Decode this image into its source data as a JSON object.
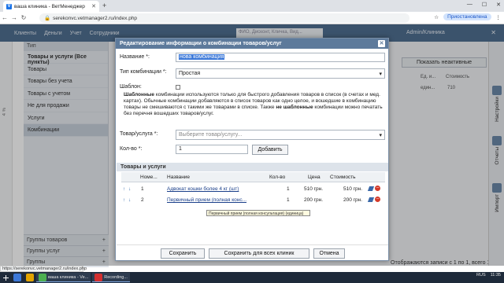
{
  "browser": {
    "tab_title": "ваша клиника - ВетМенеджер",
    "url": "serekonvc.vetmanager2.ru/index.php",
    "pause_label": "Приостановлена",
    "status_url": "https://serekonvc.vetmanager2.ru/index.php"
  },
  "app_header": {
    "menu": [
      "Клиенты",
      "Деньги",
      "Учет",
      "Сотрудники"
    ],
    "search_placeholder": "ФИО, Дисконт, Кличка, Вид...",
    "clinic": "Admin/Клиника"
  },
  "left_panel": {
    "title": "Тип",
    "items": [
      {
        "label": "Товары и услуги (Все пункты)"
      },
      {
        "label": "Товары"
      },
      {
        "label": "Товары без учета"
      },
      {
        "label": "Товары с учетом"
      },
      {
        "label": "Не для продажи"
      },
      {
        "label": "Услуги"
      },
      {
        "label": "Комбинации"
      }
    ],
    "sections": [
      "Группы товаров",
      "Группы услуг",
      "Группы"
    ],
    "percent": "4 %"
  },
  "right_area": {
    "show_inactive": "Показать неактивные",
    "columns": [
      "Ед. и...",
      "Стоимость"
    ],
    "row": [
      "един...",
      "710"
    ],
    "records": "Отображаются записи с 1 по 1, всего 1"
  },
  "right_sidebar": [
    "Настройки",
    "Отчеты",
    "Импорт"
  ],
  "modal": {
    "title": "Редактирование информации о комбинации товаров/услуг",
    "name_label": "Название *:",
    "name_value": "нова комбинация",
    "type_label": "Тип комбинации *:",
    "type_value": "Простая",
    "template_label": "Шаблон:",
    "description_bold": "Шаблонные",
    "description": "комбинации используются только для быстрого добавления товаров в список (в счетах и мед. картах). Обычные комбинации добавляются в список товаров как одно целое, и вошедшие в комбинацию товары не смешиваются с такими же товарами в списке. Также",
    "description_bold2": "не шаблонные",
    "description_end": "комбинации можно печатать без перечня вошедших товаров/услуг.",
    "product_label": "Товар/услуга *:",
    "product_placeholder": "Выберите товар/услугу...",
    "qty_label": "Кол-во *:",
    "qty_value": "1",
    "add_button": "Добавить",
    "section_title": "Товары и услуги",
    "grid_headers": [
      "Номе...",
      "Название",
      "Кол-во",
      "Цена",
      "Стоимость"
    ],
    "rows": [
      {
        "num": "1",
        "name": "Адвокат кошки более 4 кг (шт)",
        "qty": "1",
        "price": "510 грн.",
        "cost": "510 грн."
      },
      {
        "num": "2",
        "name": "Первичный прием (полная конс...",
        "qty": "1",
        "price": "200 грн.",
        "cost": "200 грн."
      }
    ],
    "tooltip": "Первичный прием (полная консультация) (единица)",
    "save": "Сохранить",
    "save_all": "Сохранить для всех клиник",
    "cancel": "Отмена"
  },
  "taskbar": {
    "apps": [
      "ваша клиника - Ve...",
      "Recording..."
    ],
    "lang": "RUS",
    "time": "11:35"
  }
}
